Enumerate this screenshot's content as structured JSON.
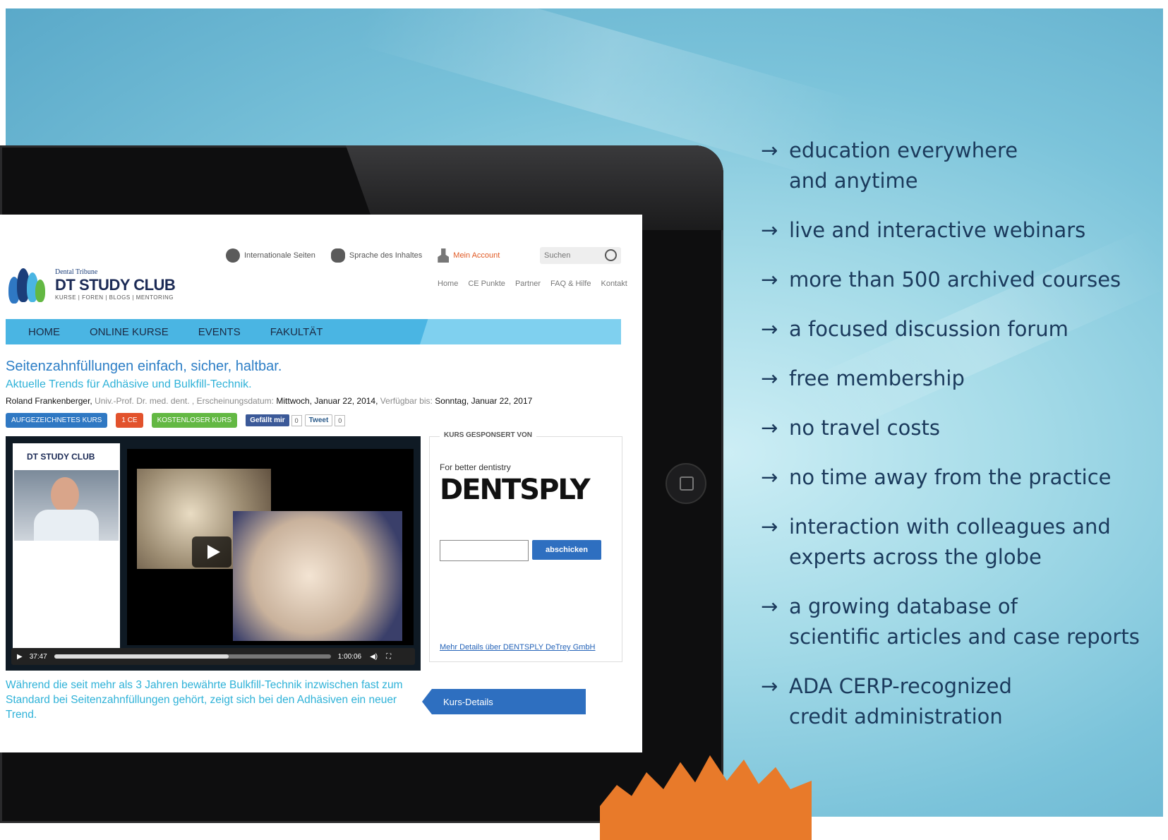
{
  "site": {
    "logo": {
      "line1": "Dental Tribune",
      "line2": "DT STUDY CLUB",
      "line3": "KURSE | FOREN | BLOGS | MENTORING"
    },
    "utils": {
      "international": "Internationale Seiten",
      "language": "Sprache des Inhaltes",
      "account": "Mein Account"
    },
    "search": {
      "placeholder": "Suchen"
    },
    "toplinks": [
      "Home",
      "CE Punkte",
      "Partner",
      "FAQ & Hilfe",
      "Kontakt"
    ],
    "nav": [
      "HOME",
      "ONLINE KURSE",
      "EVENTS",
      "FAKULTÄT"
    ],
    "article": {
      "title": "Seitenzahnfüllungen einfach, sicher, haltbar.",
      "subtitle": "Aktuelle Trends für Adhäsive und Bulkfill-Technik.",
      "author": "Roland Frankenberger,",
      "author_title": "Univ.-Prof. Dr. med. dent. ,",
      "pub_label": "Erscheinungsdatum:",
      "pub_date": "Mittwoch, Januar 22, 2014,",
      "avail_label": "Verfügbar bis:",
      "avail_date": "Sonntag, Januar 22, 2017",
      "badges": {
        "recorded": "AUFGEZEICHNETES KURS",
        "ce": "1 CE",
        "free": "KOSTENLOSER KURS"
      },
      "facebook": "Gefällt mir",
      "facebook_count": "0",
      "tweet": "Tweet",
      "tweet_count": "0"
    },
    "player": {
      "mini_logo": "DT STUDY CLUB",
      "current_time": "37:47",
      "duration": "1:00:06",
      "progress": 0.63
    },
    "sponsor": {
      "title": "KURS GESPONSERT VON",
      "tagline": "For better dentistry",
      "brand": "DENTSPLY",
      "button": "abschicken",
      "link": "Mehr Details über DENTSPLY DeTrey GmbH"
    },
    "description": "Während die seit mehr als 3 Jahren bewährte Bulkfill-Technik inzwischen fast zum Standard bei Seitenzahnfüllungen gehört, zeigt sich bei den Adhäsiven ein neuer Trend.",
    "details_button": "Kurs-Details"
  },
  "bullets": [
    {
      "line1": "education everywhere",
      "line2": "and anytime"
    },
    {
      "line1": "live and interactive webinars",
      "line2": ""
    },
    {
      "line1": "more than 500 archived courses",
      "line2": ""
    },
    {
      "line1": "a focused discussion forum",
      "line2": ""
    },
    {
      "line1": "free membership",
      "line2": ""
    },
    {
      "line1": "no travel costs",
      "line2": ""
    },
    {
      "line1": "no time away from the practice",
      "line2": ""
    },
    {
      "line1": "interaction with colleagues and",
      "line2": "experts across the globe"
    },
    {
      "line1": "a growing database of",
      "line2": "scientific articles and case reports"
    },
    {
      "line1": "ADA CERP-recognized",
      "line2": "credit administration"
    }
  ],
  "colors": {
    "nav": "#4ab5e3",
    "title": "#2c7ec6",
    "accent": "#2fb2d8",
    "button": "#2e6fc0",
    "bullet_text": "#1b3a5c",
    "burst": "#e87a2a"
  }
}
